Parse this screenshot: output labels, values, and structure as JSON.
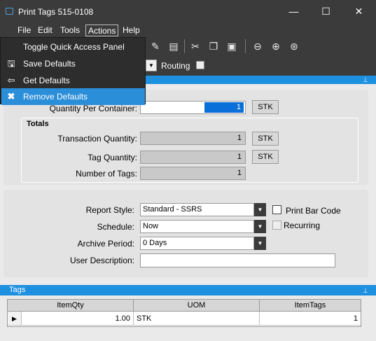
{
  "window": {
    "title": "Print Tags 515-0108",
    "minimize": "—",
    "maximize": "☐",
    "close": "✕"
  },
  "menubar": {
    "items": [
      "File",
      "Edit",
      "Tools",
      "Actions",
      "Help"
    ]
  },
  "actions_menu": {
    "items": [
      {
        "label": "Toggle Quick Access Panel",
        "icon": ""
      },
      {
        "label": "Save Defaults",
        "icon": "floppy-icon"
      },
      {
        "label": "Get Defaults",
        "icon": "get-icon"
      },
      {
        "label": "Remove Defaults",
        "icon": "x-icon",
        "highlighted": true
      }
    ]
  },
  "toolbar": {
    "routing_label": "Routing",
    "routing_checked": false
  },
  "form": {
    "quantity_per_container_label": "Quantity Per Container:",
    "quantity_per_container_value": "1",
    "quantity_per_container_uom": "STK",
    "totals_label": "Totals",
    "transaction_quantity_label": "Transaction Quantity:",
    "transaction_quantity_value": "1",
    "transaction_quantity_uom": "STK",
    "tag_quantity_label": "Tag Quantity:",
    "tag_quantity_value": "1",
    "tag_quantity_uom": "STK",
    "number_of_tags_label": "Number of Tags:",
    "number_of_tags_value": "1"
  },
  "report": {
    "report_style_label": "Report Style:",
    "report_style_value": "Standard - SSRS",
    "print_bar_code_label": "Print Bar Code",
    "schedule_label": "Schedule:",
    "schedule_value": "Now",
    "recurring_label": "Recurring",
    "archive_period_label": "Archive Period:",
    "archive_period_value": "0 Days",
    "user_description_label": "User Description:",
    "user_description_value": ""
  },
  "tags": {
    "title": "Tags",
    "columns": [
      "ItemQty",
      "UOM",
      "ItemTags"
    ],
    "rows": [
      {
        "ItemQty": "1.00",
        "UOM": "STK",
        "ItemTags": "1"
      }
    ]
  },
  "colors": {
    "accent": "#1e90e0",
    "dark": "#3b3b3b",
    "highlight": "#2a8ed8"
  }
}
